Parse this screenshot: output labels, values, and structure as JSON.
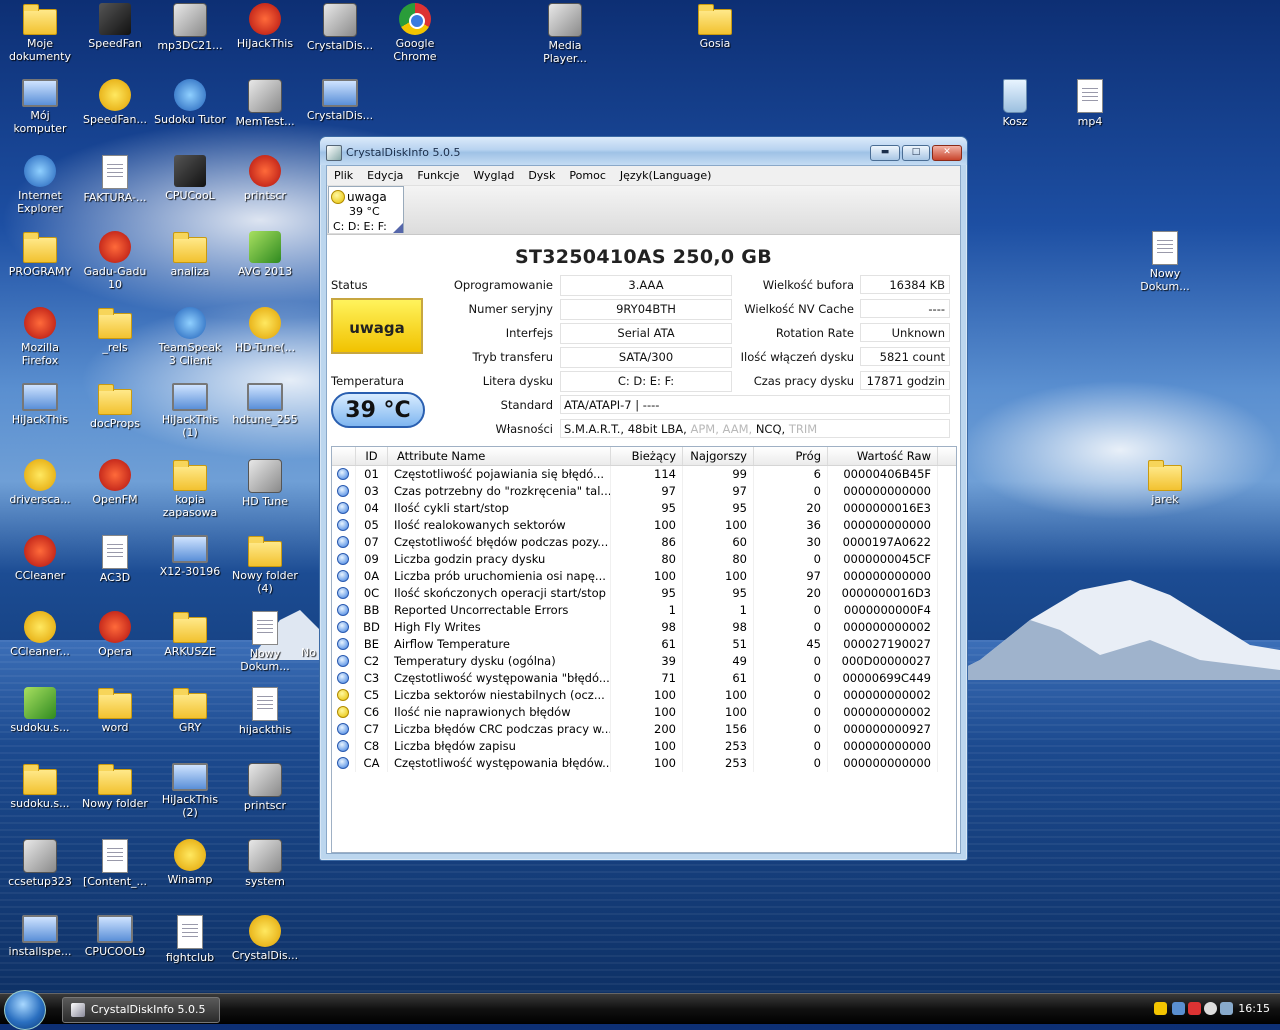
{
  "desktop": {
    "icons": [
      {
        "label": "Moje dokumenty",
        "kind": "folder"
      },
      {
        "label": "SpeedFan",
        "kind": "dark"
      },
      {
        "label": "mp3DC21...",
        "kind": "app"
      },
      {
        "label": "HiJackThis",
        "kind": "red"
      },
      {
        "label": "CrystalDis...",
        "kind": "app"
      },
      {
        "label": "Google Chrome",
        "kind": "chrome"
      },
      {
        "label": "Media Player...",
        "kind": "app"
      },
      {
        "label": "Gosia",
        "kind": "folder"
      },
      {
        "label": "Mój komputer",
        "kind": "screen"
      },
      {
        "label": "SpeedFan...",
        "kind": "yellow"
      },
      {
        "label": "Sudoku Tutor",
        "kind": "blue"
      },
      {
        "label": "MemTest...",
        "kind": "app"
      },
      {
        "label": "CrystalDis...",
        "kind": "screen"
      },
      {
        "label": "Kosz",
        "kind": "bin"
      },
      {
        "label": "mp4",
        "kind": "doc"
      },
      {
        "label": "Internet Explorer",
        "kind": "blue"
      },
      {
        "label": "FAKTURA-...",
        "kind": "doc"
      },
      {
        "label": "CPUCooL",
        "kind": "dark"
      },
      {
        "label": "printscr",
        "kind": "red"
      },
      {
        "label": "PROGRAMY",
        "kind": "folder"
      },
      {
        "label": "Gadu-Gadu 10",
        "kind": "red"
      },
      {
        "label": "analiza",
        "kind": "folder"
      },
      {
        "label": "AVG 2013",
        "kind": "green"
      },
      {
        "label": "Nowy Dokum...",
        "kind": "doc"
      },
      {
        "label": "Mozilla Firefox",
        "kind": "red"
      },
      {
        "label": "_rels",
        "kind": "folder"
      },
      {
        "label": "TeamSpeak 3 Client",
        "kind": "blue"
      },
      {
        "label": "HD-Tune(...",
        "kind": "yellow"
      },
      {
        "label": "HiJackThis",
        "kind": "screen"
      },
      {
        "label": "docProps",
        "kind": "folder"
      },
      {
        "label": "HiJackThis (1)",
        "kind": "screen"
      },
      {
        "label": "hdtune_255",
        "kind": "screen"
      },
      {
        "label": "driversca...",
        "kind": "yellow"
      },
      {
        "label": "OpenFM",
        "kind": "red"
      },
      {
        "label": "kopia zapasowa",
        "kind": "folder"
      },
      {
        "label": "HD Tune",
        "kind": "app"
      },
      {
        "label": "jarek",
        "kind": "folder"
      },
      {
        "label": "CCleaner",
        "kind": "red"
      },
      {
        "label": "AC3D",
        "kind": "doc"
      },
      {
        "label": "X12-30196",
        "kind": "screen"
      },
      {
        "label": "Nowy folder (4)",
        "kind": "folder"
      },
      {
        "label": "CCleaner...",
        "kind": "yellow"
      },
      {
        "label": "Opera",
        "kind": "red"
      },
      {
        "label": "ARKUSZE",
        "kind": "folder"
      },
      {
        "label": "Nowy Dokum...",
        "kind": "doc"
      },
      {
        "label": "sudoku.s...",
        "kind": "green"
      },
      {
        "label": "word",
        "kind": "folder"
      },
      {
        "label": "GRY",
        "kind": "folder"
      },
      {
        "label": "hijackthis",
        "kind": "doc"
      },
      {
        "label": "sudoku.s...",
        "kind": "folder"
      },
      {
        "label": "Nowy folder",
        "kind": "folder"
      },
      {
        "label": "HiJackThis (2)",
        "kind": "screen"
      },
      {
        "label": "printscr",
        "kind": "app"
      },
      {
        "label": "ccsetup323",
        "kind": "app"
      },
      {
        "label": "[Content_...",
        "kind": "doc"
      },
      {
        "label": "Winamp",
        "kind": "yellow"
      },
      {
        "label": "system",
        "kind": "app"
      },
      {
        "label": "installspe...",
        "kind": "screen"
      },
      {
        "label": "CPUCOOL9",
        "kind": "screen"
      },
      {
        "label": "fightclub",
        "kind": "doc"
      },
      {
        "label": "CrystalDis...",
        "kind": "yellow"
      }
    ],
    "partial_label": "No"
  },
  "window": {
    "title": "CrystalDiskInfo 5.0.5",
    "controls": {
      "minimize": "▬",
      "maximize": "□",
      "close": "✕"
    },
    "menu": [
      "Plik",
      "Edycja",
      "Funkcje",
      "Wygląd",
      "Dysk",
      "Pomoc",
      "Język(Language)"
    ],
    "disk_tab": {
      "status": "uwaga",
      "temp": "39 °C",
      "letters": "C: D: E: F:"
    },
    "disk_title": "ST3250410AS  250,0 GB",
    "status_label": "Status",
    "status_value": "uwaga",
    "temp_label": "Temperatura",
    "temp_value": "39 °C",
    "fields_mid": [
      {
        "label": "Oprogramowanie",
        "value": "3.AAA"
      },
      {
        "label": "Numer seryjny",
        "value": "9RY04BTH"
      },
      {
        "label": "Interfejs",
        "value": "Serial ATA"
      },
      {
        "label": "Tryb transferu",
        "value": "SATA/300"
      },
      {
        "label": "Litera dysku",
        "value": "C: D: E: F:"
      }
    ],
    "fields_right": [
      {
        "label": "Wielkość bufora",
        "value": "16384 KB"
      },
      {
        "label": "Wielkość NV Cache",
        "value": "----"
      },
      {
        "label": "Rotation Rate",
        "value": "Unknown"
      },
      {
        "label": "Ilość włączeń dysku",
        "value": "5821 count"
      },
      {
        "label": "Czas pracy dysku",
        "value": "17871 godzin"
      }
    ],
    "standard_label": "Standard",
    "standard_value": "ATA/ATAPI-7 | ----",
    "features_label": "Własności",
    "features": {
      "active": "S.M.A.R.T., 48bit LBA,",
      "apm": "APM,",
      "aam": "AAM,",
      "ncq": "NCQ,",
      "trim": "TRIM"
    },
    "table": {
      "headers": {
        "id": "ID",
        "name": "Attribute Name",
        "current": "Bieżący",
        "worst": "Najgorszy",
        "threshold": "Próg",
        "raw": "Wartość Raw"
      },
      "rows": [
        {
          "status": "good",
          "id": "01",
          "name": "Częstotliwość pojawiania się błędó...",
          "current": "114",
          "worst": "99",
          "threshold": "6",
          "raw": "00000406B45F"
        },
        {
          "status": "good",
          "id": "03",
          "name": "Czas potrzebny do \"rozkręcenia\" tal...",
          "current": "97",
          "worst": "97",
          "threshold": "0",
          "raw": "000000000000"
        },
        {
          "status": "good",
          "id": "04",
          "name": "Ilość cykli start/stop",
          "current": "95",
          "worst": "95",
          "threshold": "20",
          "raw": "0000000016E3"
        },
        {
          "status": "good",
          "id": "05",
          "name": "Ilość realokowanych sektorów",
          "current": "100",
          "worst": "100",
          "threshold": "36",
          "raw": "000000000000"
        },
        {
          "status": "good",
          "id": "07",
          "name": "Częstotliwość błędów podczas pozy...",
          "current": "86",
          "worst": "60",
          "threshold": "30",
          "raw": "0000197A0622"
        },
        {
          "status": "good",
          "id": "09",
          "name": "Liczba godzin pracy dysku",
          "current": "80",
          "worst": "80",
          "threshold": "0",
          "raw": "0000000045CF"
        },
        {
          "status": "good",
          "id": "0A",
          "name": "Liczba prób uruchomienia osi napę...",
          "current": "100",
          "worst": "100",
          "threshold": "97",
          "raw": "000000000000"
        },
        {
          "status": "good",
          "id": "0C",
          "name": "Ilość skończonych operacji start/stop",
          "current": "95",
          "worst": "95",
          "threshold": "20",
          "raw": "0000000016D3"
        },
        {
          "status": "good",
          "id": "BB",
          "name": "Reported Uncorrectable Errors",
          "current": "1",
          "worst": "1",
          "threshold": "0",
          "raw": "0000000000F4"
        },
        {
          "status": "good",
          "id": "BD",
          "name": "High Fly Writes",
          "current": "98",
          "worst": "98",
          "threshold": "0",
          "raw": "000000000002"
        },
        {
          "status": "good",
          "id": "BE",
          "name": "Airflow Temperature",
          "current": "61",
          "worst": "51",
          "threshold": "45",
          "raw": "000027190027"
        },
        {
          "status": "good",
          "id": "C2",
          "name": "Temperatury dysku (ogólna)",
          "current": "39",
          "worst": "49",
          "threshold": "0",
          "raw": "000D00000027"
        },
        {
          "status": "good",
          "id": "C3",
          "name": "Częstotliwość występowania \"błędó...",
          "current": "71",
          "worst": "61",
          "threshold": "0",
          "raw": "00000699C449"
        },
        {
          "status": "warn",
          "id": "C5",
          "name": "Liczba sektorów niestabilnych (ocz...",
          "current": "100",
          "worst": "100",
          "threshold": "0",
          "raw": "000000000002"
        },
        {
          "status": "warn",
          "id": "C6",
          "name": "Ilość nie naprawionych błędów",
          "current": "100",
          "worst": "100",
          "threshold": "0",
          "raw": "000000000002"
        },
        {
          "status": "good",
          "id": "C7",
          "name": "Liczba błędów CRC podczas pracy w...",
          "current": "200",
          "worst": "156",
          "threshold": "0",
          "raw": "000000000927"
        },
        {
          "status": "good",
          "id": "C8",
          "name": "Liczba błędów zapisu",
          "current": "100",
          "worst": "253",
          "threshold": "0",
          "raw": "000000000000"
        },
        {
          "status": "good",
          "id": "CA",
          "name": "Częstotliwość występowania błędów...",
          "current": "100",
          "worst": "253",
          "threshold": "0",
          "raw": "000000000000"
        }
      ]
    }
  },
  "taskbar": {
    "task_label": "CrystalDiskInfo 5.0.5",
    "clock": "16:15"
  }
}
